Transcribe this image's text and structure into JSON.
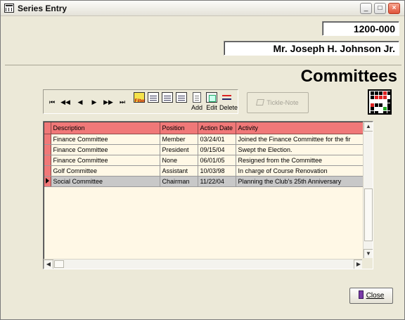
{
  "window": {
    "title": "Series Entry",
    "controls": {
      "minimize": "_",
      "maximize": "□",
      "close": "×"
    }
  },
  "header": {
    "id_value": "1200-000",
    "name_value": "Mr. Joseph H. Johnson Jr."
  },
  "page_title": "Committees",
  "toolbar": {
    "nav": {
      "first": "⏮",
      "prev_page": "◀◀",
      "prev": "◀",
      "next": "▶",
      "next_page": "▶▶",
      "last": "⏭"
    },
    "filter_sub": "Filter",
    "add_label": "Add",
    "edit_label": "Edit",
    "delete_label": "Delete",
    "tickle_label": "Tickle-Note"
  },
  "grid": {
    "columns": [
      "Description",
      "Position",
      "Action Date",
      "Activity"
    ],
    "rows": [
      [
        "Finance Committee",
        "Member",
        "03/24/01",
        "Joined the Finance Committee for the fir"
      ],
      [
        "Finance Committee",
        "President",
        "09/15/04",
        "Swept the Election."
      ],
      [
        "Finance Committee",
        "None",
        "06/01/05",
        "Resigned from the Committee"
      ],
      [
        "Golf Committee",
        "Assistant",
        "10/03/98",
        "In charge of Course Renovation"
      ],
      [
        "Social Committee",
        "Chairman",
        "11/22/04",
        "Planning the Club's 25th Anniversary"
      ]
    ],
    "selected_row": 4
  },
  "close_button": {
    "label": "Close"
  },
  "colors": {
    "header_red": "#f07878",
    "grid_bg": "#fff8e6",
    "window_bg": "#ece9d8"
  }
}
